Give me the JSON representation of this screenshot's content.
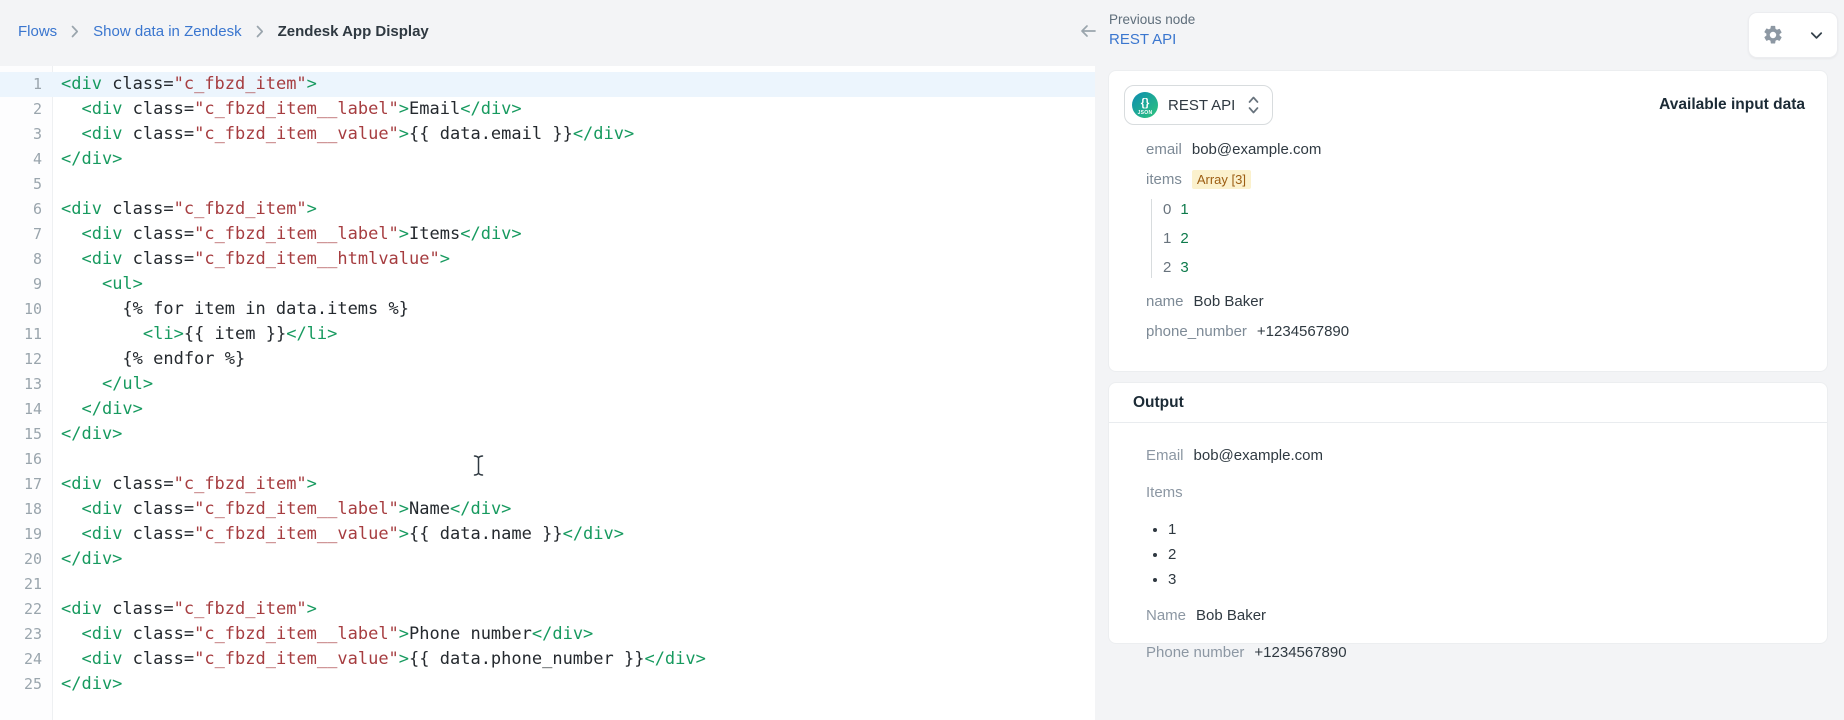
{
  "breadcrumb": {
    "items": [
      "Flows",
      "Show data in Zendesk"
    ],
    "current": "Zendesk App Display"
  },
  "header": {
    "previous_node_label": "Previous node",
    "previous_node_name": "REST API"
  },
  "editor": {
    "active_line": 1,
    "lines": [
      [
        [
          "tag",
          "<div"
        ],
        [
          "txt",
          " class="
        ],
        [
          "str",
          "\"c_fbzd_item\""
        ],
        [
          "tag",
          ">"
        ]
      ],
      [
        [
          "txt",
          "  "
        ],
        [
          "tag",
          "<div"
        ],
        [
          "txt",
          " class="
        ],
        [
          "str",
          "\"c_fbzd_item__label\""
        ],
        [
          "tag",
          ">"
        ],
        [
          "txt",
          "Email"
        ],
        [
          "tag",
          "</div>"
        ]
      ],
      [
        [
          "txt",
          "  "
        ],
        [
          "tag",
          "<div"
        ],
        [
          "txt",
          " class="
        ],
        [
          "str",
          "\"c_fbzd_item__value\""
        ],
        [
          "tag",
          ">"
        ],
        [
          "txt",
          "{{ data.email }}"
        ],
        [
          "tag",
          "</div>"
        ]
      ],
      [
        [
          "tag",
          "</div>"
        ]
      ],
      [],
      [
        [
          "tag",
          "<div"
        ],
        [
          "txt",
          " class="
        ],
        [
          "str",
          "\"c_fbzd_item\""
        ],
        [
          "tag",
          ">"
        ]
      ],
      [
        [
          "txt",
          "  "
        ],
        [
          "tag",
          "<div"
        ],
        [
          "txt",
          " class="
        ],
        [
          "str",
          "\"c_fbzd_item__label\""
        ],
        [
          "tag",
          ">"
        ],
        [
          "txt",
          "Items"
        ],
        [
          "tag",
          "</div>"
        ]
      ],
      [
        [
          "txt",
          "  "
        ],
        [
          "tag",
          "<div"
        ],
        [
          "txt",
          " class="
        ],
        [
          "str",
          "\"c_fbzd_item__htmlvalue\""
        ],
        [
          "tag",
          ">"
        ]
      ],
      [
        [
          "txt",
          "    "
        ],
        [
          "tag",
          "<ul>"
        ]
      ],
      [
        [
          "txt",
          "      {% for item in data.items %}"
        ]
      ],
      [
        [
          "txt",
          "        "
        ],
        [
          "tag",
          "<li>"
        ],
        [
          "txt",
          "{{ item }}"
        ],
        [
          "tag",
          "</li>"
        ]
      ],
      [
        [
          "txt",
          "      {% endfor %}"
        ]
      ],
      [
        [
          "txt",
          "    "
        ],
        [
          "tag",
          "</ul>"
        ]
      ],
      [
        [
          "txt",
          "  "
        ],
        [
          "tag",
          "</div>"
        ]
      ],
      [
        [
          "tag",
          "</div>"
        ]
      ],
      [],
      [
        [
          "tag",
          "<div"
        ],
        [
          "txt",
          " class="
        ],
        [
          "str",
          "\"c_fbzd_item\""
        ],
        [
          "tag",
          ">"
        ]
      ],
      [
        [
          "txt",
          "  "
        ],
        [
          "tag",
          "<div"
        ],
        [
          "txt",
          " class="
        ],
        [
          "str",
          "\"c_fbzd_item__label\""
        ],
        [
          "tag",
          ">"
        ],
        [
          "txt",
          "Name"
        ],
        [
          "tag",
          "</div>"
        ]
      ],
      [
        [
          "txt",
          "  "
        ],
        [
          "tag",
          "<div"
        ],
        [
          "txt",
          " class="
        ],
        [
          "str",
          "\"c_fbzd_item__value\""
        ],
        [
          "tag",
          ">"
        ],
        [
          "txt",
          "{{ data.name }}"
        ],
        [
          "tag",
          "</div>"
        ]
      ],
      [
        [
          "tag",
          "</div>"
        ]
      ],
      [],
      [
        [
          "tag",
          "<div"
        ],
        [
          "txt",
          " class="
        ],
        [
          "str",
          "\"c_fbzd_item\""
        ],
        [
          "tag",
          ">"
        ]
      ],
      [
        [
          "txt",
          "  "
        ],
        [
          "tag",
          "<div"
        ],
        [
          "txt",
          " class="
        ],
        [
          "str",
          "\"c_fbzd_item__label\""
        ],
        [
          "tag",
          ">"
        ],
        [
          "txt",
          "Phone number"
        ],
        [
          "tag",
          "</div>"
        ]
      ],
      [
        [
          "txt",
          "  "
        ],
        [
          "tag",
          "<div"
        ],
        [
          "txt",
          " class="
        ],
        [
          "str",
          "\"c_fbzd_item__value\""
        ],
        [
          "tag",
          ">"
        ],
        [
          "txt",
          "{{ data.phone_number }}"
        ],
        [
          "tag",
          "</div>"
        ]
      ],
      [
        [
          "tag",
          "</div>"
        ]
      ]
    ]
  },
  "input_panel": {
    "node_selector": {
      "label": "REST API",
      "icon": "json-icon",
      "icon_braces": "{}",
      "icon_caption": "JSON"
    },
    "heading": "Available input data",
    "fields": [
      {
        "key": "email",
        "value": "bob@example.com"
      },
      {
        "key": "items",
        "badge": "Array [3]",
        "children": [
          {
            "index": "0",
            "value": "1"
          },
          {
            "index": "1",
            "value": "2"
          },
          {
            "index": "2",
            "value": "3"
          }
        ]
      },
      {
        "key": "name",
        "value": "Bob Baker"
      },
      {
        "key": "phone_number",
        "value": "+1234567890"
      }
    ]
  },
  "output_panel": {
    "heading": "Output",
    "rows": [
      {
        "label": "Email",
        "value": "bob@example.com"
      },
      {
        "label": "Items",
        "list": [
          "1",
          "2",
          "3"
        ]
      },
      {
        "label": "Name",
        "value": "Bob Baker"
      },
      {
        "label": "Phone number",
        "value": "+1234567890"
      }
    ]
  },
  "colors": {
    "page_background": "#f3f4f6",
    "link_blue": "#3a76cf",
    "text_dark": "#2f3941",
    "label_gray": "#7d8a96",
    "syntax_tag_green": "#179a5f",
    "syntax_string_red": "#a63d40",
    "array_value_green": "#0d7a4b",
    "badge_background": "#fbf1cd",
    "badge_text": "#9c5d12",
    "active_line_blue": "#ecf5fd",
    "json_icon_gradient": [
      "#0f8fae",
      "#2cc27e"
    ]
  }
}
